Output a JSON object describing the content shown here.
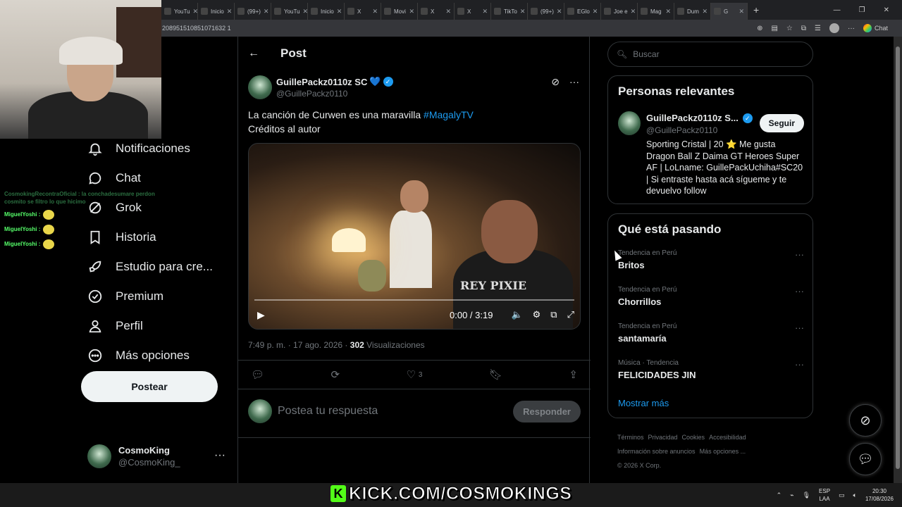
{
  "browser": {
    "tabs": [
      {
        "label": "YouTu",
        "icon": "youtube-icon"
      },
      {
        "label": "Inicio",
        "icon": "x-icon"
      },
      {
        "label": "(99+)",
        "icon": "tiktok-icon"
      },
      {
        "label": "YouTu",
        "icon": "youtube-icon"
      },
      {
        "label": "Inicio",
        "icon": "x-icon"
      },
      {
        "label": "X",
        "icon": "x-icon"
      },
      {
        "label": "Movi",
        "icon": "x-icon"
      },
      {
        "label": "X",
        "icon": "x-icon"
      },
      {
        "label": "X",
        "icon": "x-icon"
      },
      {
        "label": "TikTo",
        "icon": "tiktok-icon"
      },
      {
        "label": "(99+)",
        "icon": "tiktok-icon"
      },
      {
        "label": "EGlo",
        "icon": "globe-icon"
      },
      {
        "label": "Joe e",
        "icon": "x-icon"
      },
      {
        "label": "Mag",
        "icon": "x-icon"
      },
      {
        "label": "Dum",
        "icon": "x-icon"
      },
      {
        "label": "G",
        "icon": "x-icon"
      }
    ],
    "url": "208951510851071632 1",
    "chat_label": "Chat"
  },
  "kick_chat": {
    "system_line": "CosmokingRecontraOficial : la conchadesumare perdon cosmito se filtro lo que hicimo",
    "messages": [
      {
        "user": "MiguelYoshi :"
      },
      {
        "user": "MiguelYoshi :"
      },
      {
        "user": "MiguelYoshi :"
      }
    ]
  },
  "nav": {
    "items": [
      {
        "label": "Notificaciones",
        "icon": "bell-icon"
      },
      {
        "label": "Chat",
        "icon": "chat-bubble-icon"
      },
      {
        "label": "Grok",
        "icon": "grok-icon"
      },
      {
        "label": "Historia",
        "icon": "bookmark-icon"
      },
      {
        "label": "Estudio para cre...",
        "icon": "rocket-icon"
      },
      {
        "label": "Premium",
        "icon": "verified-badge-icon"
      },
      {
        "label": "Perfil",
        "icon": "person-icon"
      },
      {
        "label": "Más opciones",
        "icon": "more-circle-icon"
      }
    ],
    "post_button": "Postear",
    "account": {
      "name": "CosmoKing",
      "handle": "@CosmoKing_",
      "more": "···"
    }
  },
  "post": {
    "header_title": "Post",
    "back_icon": "arrow-left-icon",
    "author_name": "GuillePackz0110z SC",
    "author_emoji": "💙",
    "author_handle": "@GuillePackz0110",
    "text_line1": "La canción de Curwen es una maravilla ",
    "hashtag": "#MagalyTV",
    "text_line2": "Créditos al autor",
    "video": {
      "time": "0:00 / 3:19",
      "shirt_text": "REY PIXIE",
      "progress": 0
    },
    "timestamp": "7:49 p. m. · 17 ago. 2026 · ",
    "views_count": "302",
    "views_label": " Visualizaciones",
    "likes": "3",
    "reply_placeholder": "Postea tu respuesta",
    "reply_button": "Responder"
  },
  "right": {
    "search_placeholder": "Buscar",
    "relevant_title": "Personas relevantes",
    "relevant": {
      "name": "GuillePackz0110z S...",
      "handle": "@GuillePackz0110",
      "follow": "Seguir",
      "bio": "Sporting Cristal | 20 ⭐ Me gusta Dragon Ball Z Daima GT Heroes Super AF | LoLname: GuillePackUchiha#SC20 | Si entraste hasta acá sígueme y te devuelvo follow"
    },
    "trends_title": "Qué está pasando",
    "trends": [
      {
        "category": "Tendencia en Perú",
        "title": "Britos"
      },
      {
        "category": "Tendencia en Perú",
        "title": "Chorrillos"
      },
      {
        "category": "Tendencia en Perú",
        "title": "santamaría"
      },
      {
        "category": "Música · Tendencia",
        "title": "FELICIDADES JIN"
      }
    ],
    "show_more": "Mostrar más",
    "footer": [
      "Términos",
      "Privacidad",
      "Cookies",
      "Accesibilidad",
      "Información sobre anuncios",
      "Más opciones ...",
      "© 2026 X Corp."
    ]
  },
  "overlay": {
    "kick_text": "KICK.COM/COSMOKINGS"
  },
  "taskbar": {
    "lang1": "ESP",
    "lang2": "LAA",
    "time": "20:30",
    "date": "17/08/2026"
  }
}
